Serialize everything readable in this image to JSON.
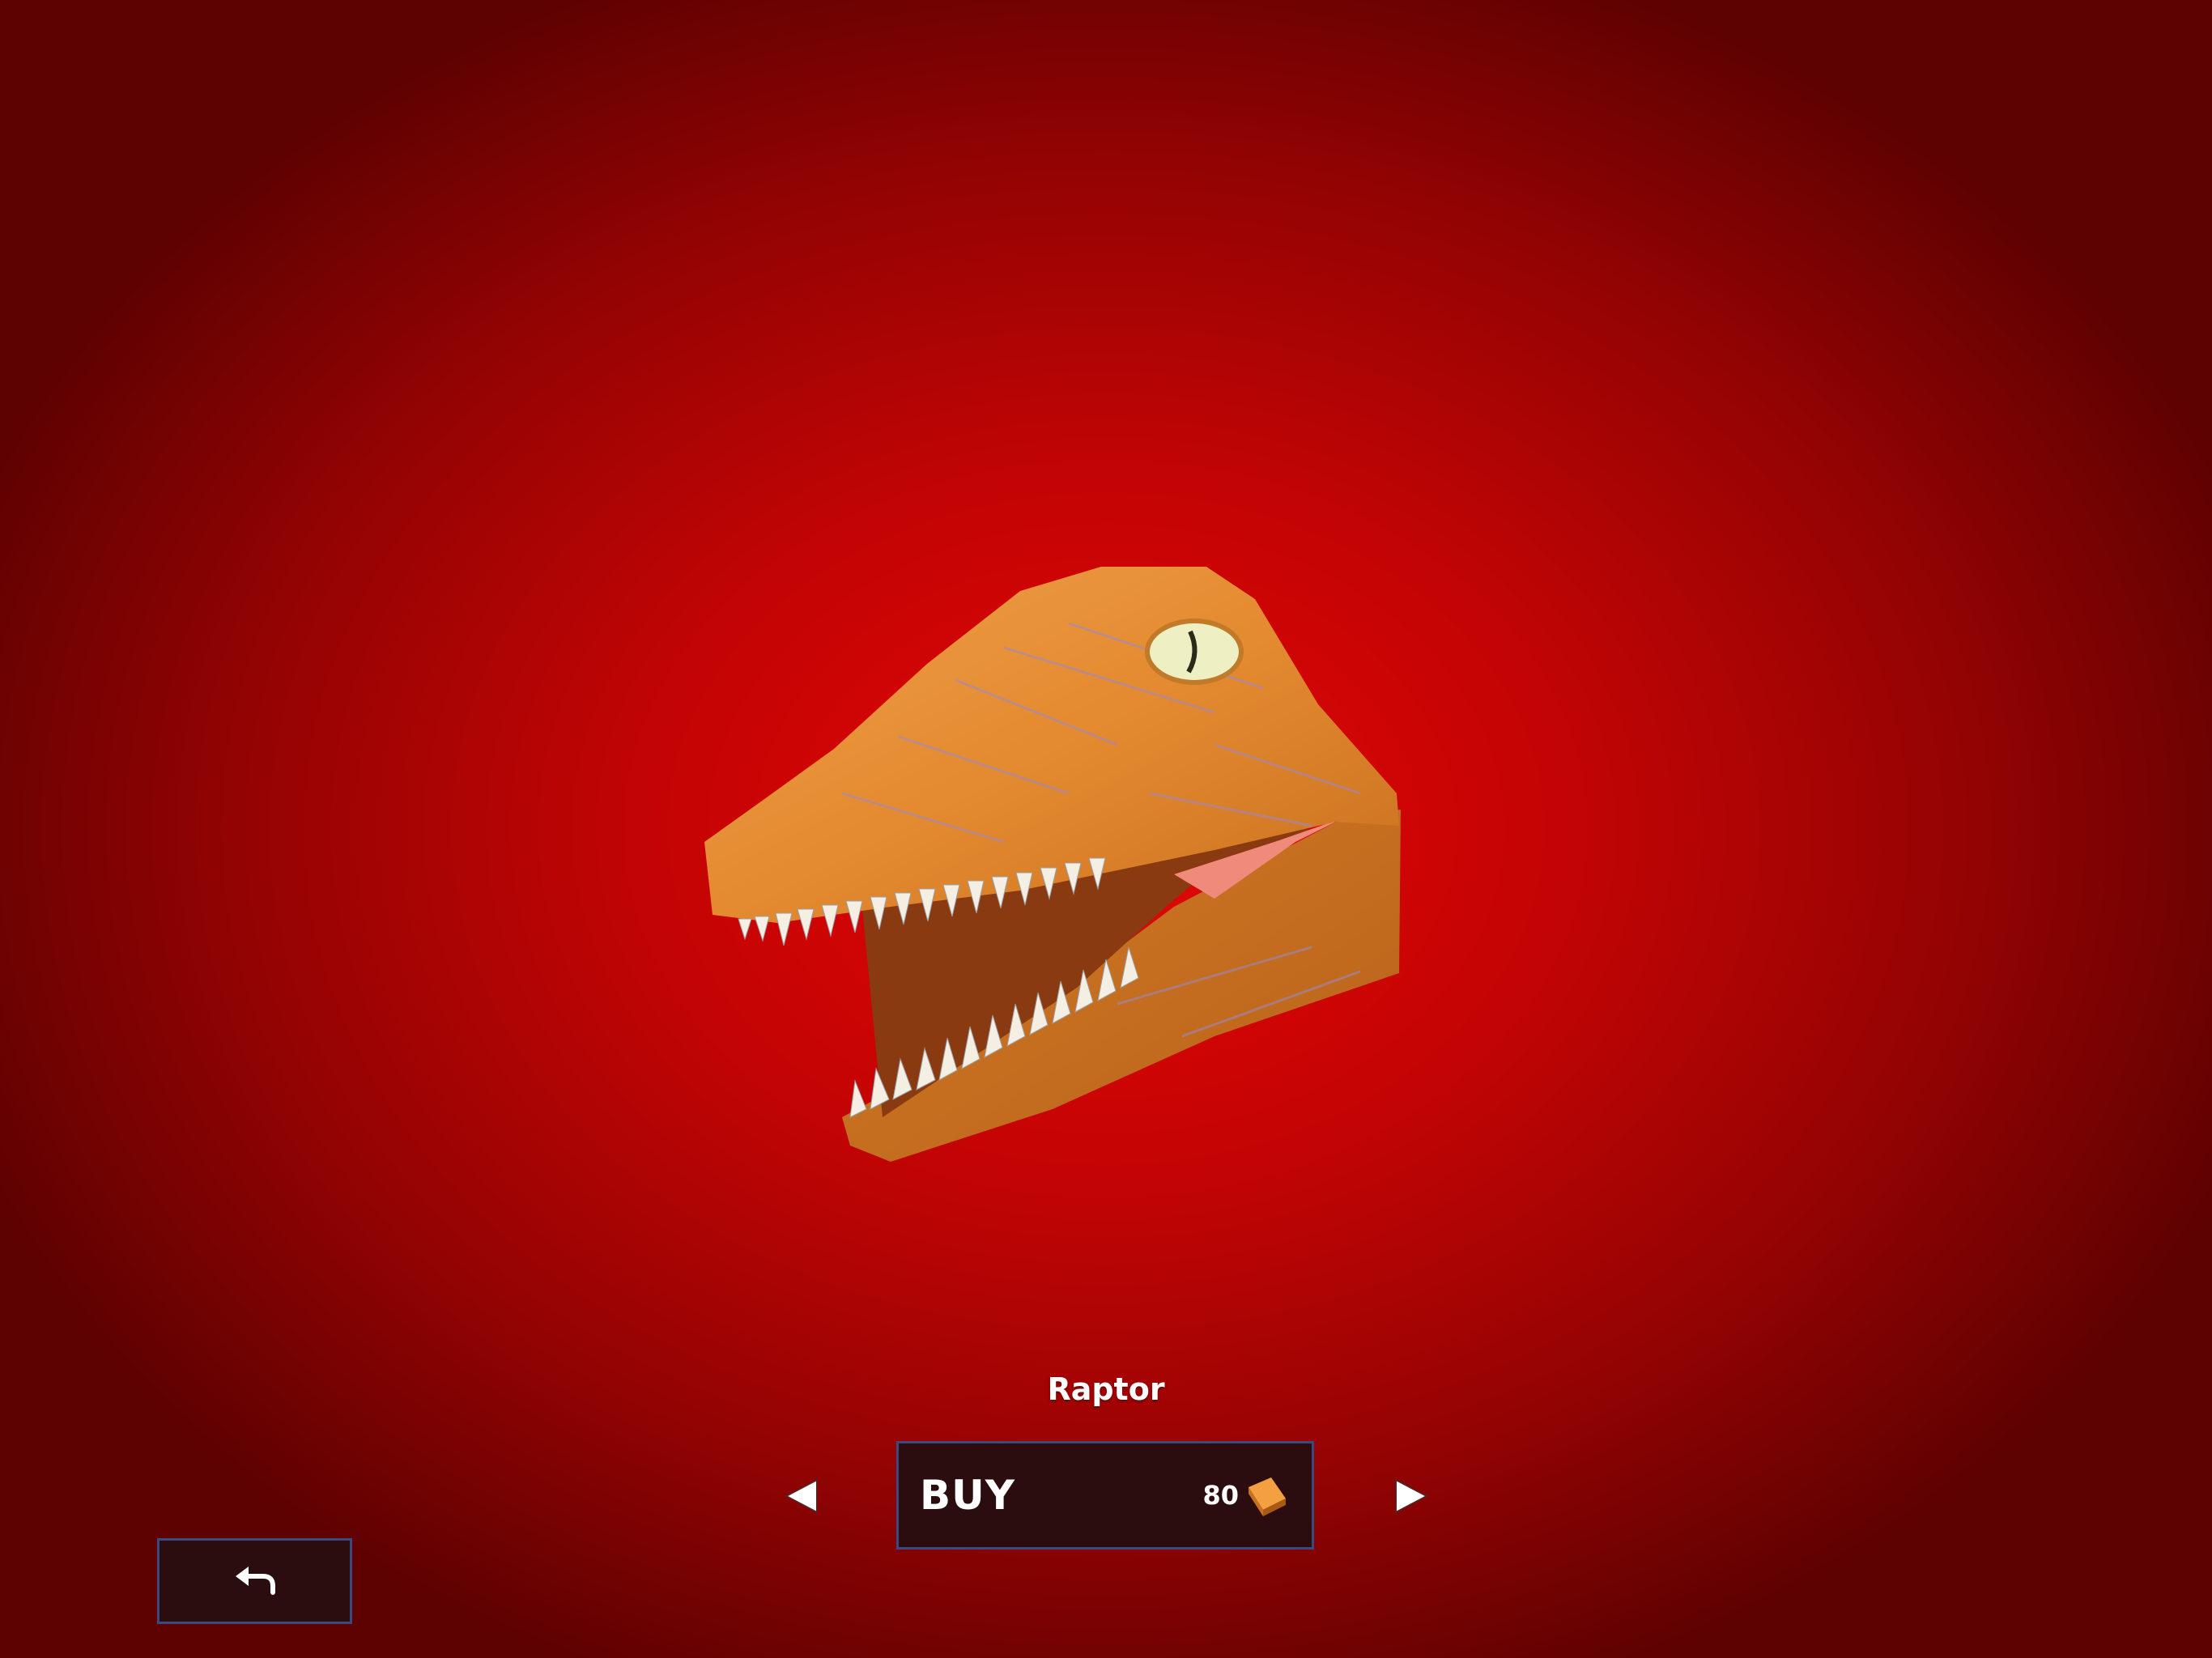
{
  "item": {
    "name": "Raptor",
    "model_icon": "raptor-head"
  },
  "buy_button": {
    "label": "BUY",
    "price": "80",
    "currency_icon": "brick-icon"
  },
  "navigation": {
    "prev_icon": "triangle-left-icon",
    "next_icon": "triangle-right-icon",
    "back_icon": "return-arrow-icon"
  },
  "colors": {
    "background_center": "#e30606",
    "background_edge": "#5e0101",
    "button_fill": "#2c0d0f",
    "button_border": "#3b4a7e",
    "text": "#ffffff",
    "raptor_skin": "#e58a2e",
    "currency": "#e88a2a"
  }
}
